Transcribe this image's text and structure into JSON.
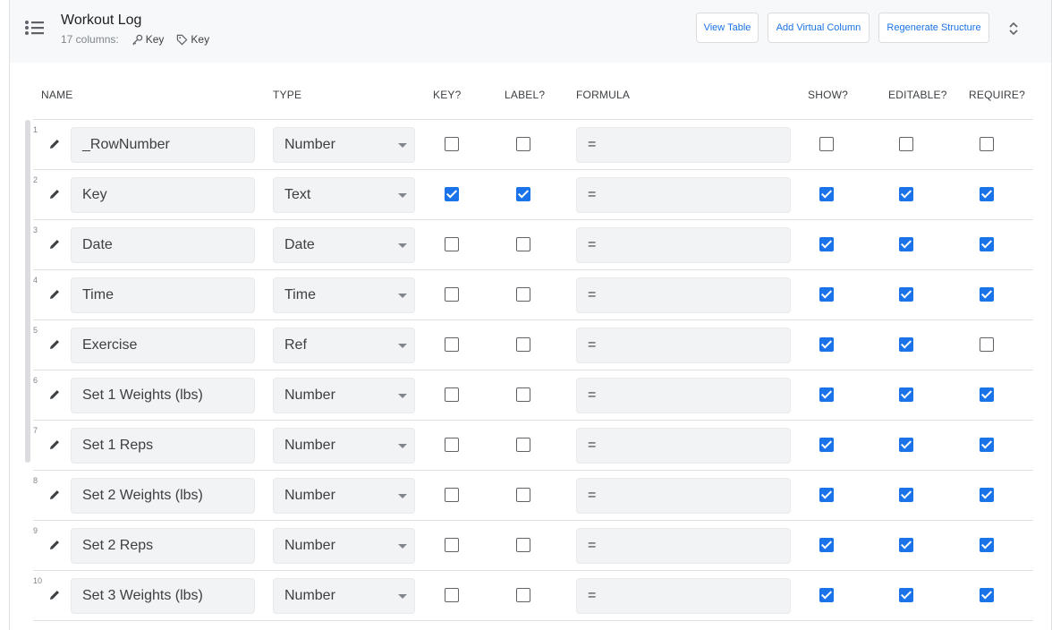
{
  "header": {
    "title": "Workout Log",
    "column_count": "17 columns:",
    "key_tags": [
      "Key",
      "Key"
    ],
    "buttons": {
      "view_table": "View Table",
      "add_virtual_column": "Add Virtual Column",
      "regenerate_structure": "Regenerate Structure"
    }
  },
  "columns_header": {
    "name": "NAME",
    "type": "TYPE",
    "key": "KEY?",
    "label": "LABEL?",
    "formula": "FORMULA",
    "show": "SHOW?",
    "editable": "EDITABLE?",
    "require": "REQUIRE?"
  },
  "rows": [
    {
      "num": "1",
      "name": "_RowNumber",
      "type": "Number",
      "formula": "=",
      "key": false,
      "label": false,
      "show": false,
      "editable": false,
      "require": false
    },
    {
      "num": "2",
      "name": "Key",
      "type": "Text",
      "formula": "=",
      "key": true,
      "label": true,
      "show": true,
      "editable": true,
      "require": true
    },
    {
      "num": "3",
      "name": "Date",
      "type": "Date",
      "formula": "=",
      "key": false,
      "label": false,
      "show": true,
      "editable": true,
      "require": true
    },
    {
      "num": "4",
      "name": "Time",
      "type": "Time",
      "formula": "=",
      "key": false,
      "label": false,
      "show": true,
      "editable": true,
      "require": true
    },
    {
      "num": "5",
      "name": "Exercise",
      "type": "Ref",
      "formula": "=",
      "key": false,
      "label": false,
      "show": true,
      "editable": true,
      "require": false
    },
    {
      "num": "6",
      "name": "Set 1 Weights (lbs)",
      "type": "Number",
      "formula": "=",
      "key": false,
      "label": false,
      "show": true,
      "editable": true,
      "require": true
    },
    {
      "num": "7",
      "name": "Set 1 Reps",
      "type": "Number",
      "formula": "=",
      "key": false,
      "label": false,
      "show": true,
      "editable": true,
      "require": true
    },
    {
      "num": "8",
      "name": "Set 2 Weights (lbs)",
      "type": "Number",
      "formula": "=",
      "key": false,
      "label": false,
      "show": true,
      "editable": true,
      "require": true
    },
    {
      "num": "9",
      "name": "Set 2 Reps",
      "type": "Number",
      "formula": "=",
      "key": false,
      "label": false,
      "show": true,
      "editable": true,
      "require": true
    },
    {
      "num": "10",
      "name": "Set 3 Weights (lbs)",
      "type": "Number",
      "formula": "=",
      "key": false,
      "label": false,
      "show": true,
      "editable": true,
      "require": true
    }
  ],
  "colors": {
    "accent": "#1a73e8",
    "header_bg": "#f6f8fa",
    "field_bg": "#f1f3f4"
  },
  "icons": {
    "menu": "list-icon",
    "key": "key-icon",
    "label": "tag-icon",
    "edit": "pencil-icon",
    "collapse": "unfold-icon"
  }
}
